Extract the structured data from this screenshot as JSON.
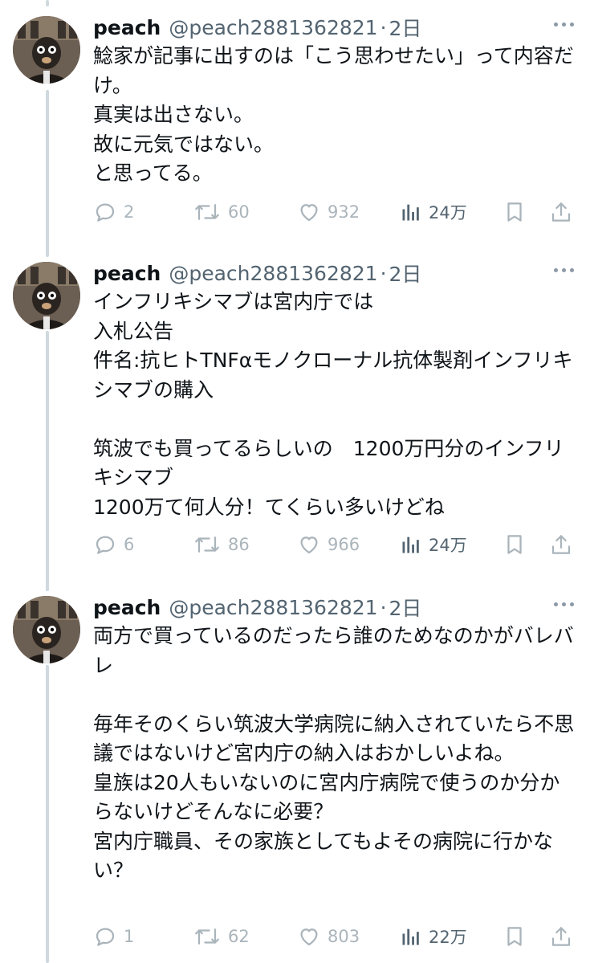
{
  "tweets": [
    {
      "name": "peach",
      "handle": "@peach2881362821",
      "time": "2日",
      "text": "鯰家が記事に出すのは「こう思わせたい」って内容だけ。\n真実は出さない。\n故に元気ではない。\nと思ってる。",
      "replies": "2",
      "retweets": "60",
      "likes": "932",
      "views": "24万"
    },
    {
      "name": "peach",
      "handle": "@peach2881362821",
      "time": "2日",
      "text": "インフリキシマブは宮内庁では\n入札公告\n件名:抗ヒトTNFαモノクローナル抗体製剤インフリキシマブの購入\n\n筑波でも買ってるらしいの　1200万円分のインフリキシマブ\n1200万て何人分！てくらい多いけどね",
      "replies": "6",
      "retweets": "86",
      "likes": "966",
      "views": "24万"
    },
    {
      "name": "peach",
      "handle": "@peach2881362821",
      "time": "2日",
      "text": "両方で買っているのだったら誰のためなのかがバレバレ\n\n毎年そのくらい筑波大学病院に納入されていたら不思議ではないけど宮内庁の納入はおかしいよね。\n皇族は20人もいないのに宮内庁病院で使うのか分からないけどそんなに必要？\n宮内庁職員、その家族としてもよその病院に行かない？",
      "replies": "1",
      "retweets": "62",
      "likes": "803",
      "views": "22万"
    }
  ],
  "icons": [
    "avatar-photo",
    "more-icon",
    "reply-icon",
    "retweet-icon",
    "like-icon",
    "views-icon",
    "bookmark-icon",
    "share-icon"
  ],
  "colors": {
    "text": "#0f1419",
    "secondary": "#536471",
    "muted": "#aab4bb",
    "thread_line": "#cfd9de"
  }
}
